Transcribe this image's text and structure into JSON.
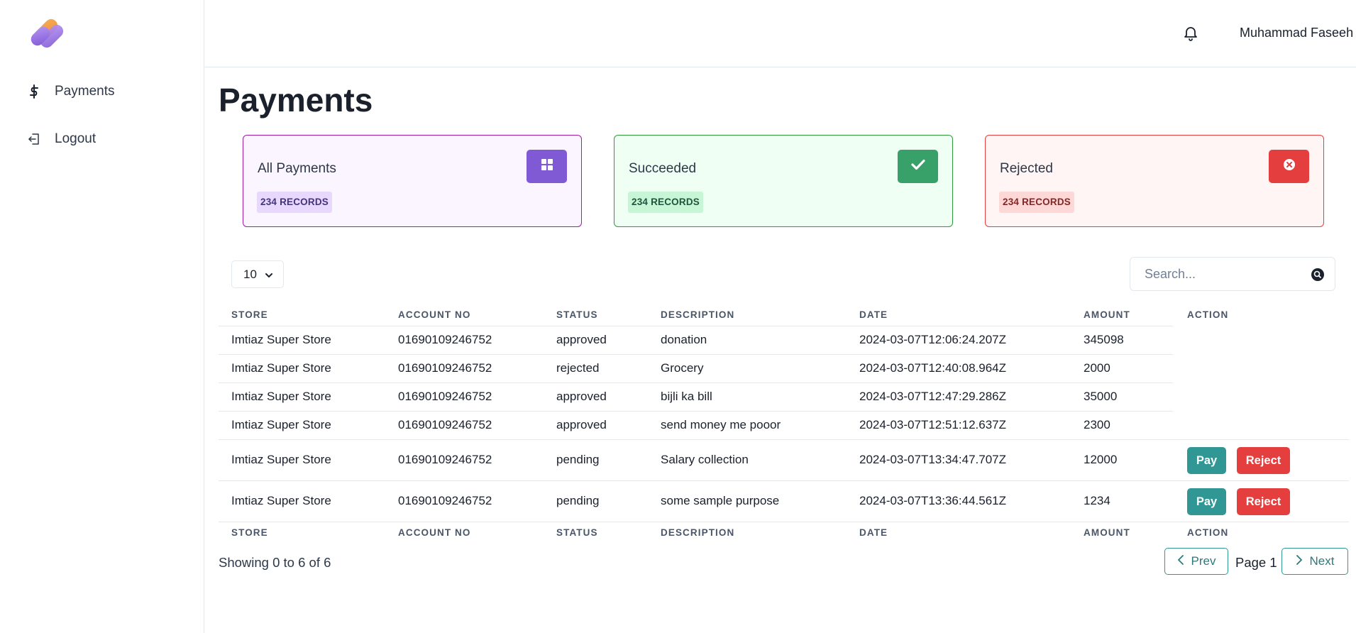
{
  "sidebar": {
    "logo_icon": "brand-logo",
    "items": [
      {
        "label": "Payments",
        "icon": "dollar-icon"
      },
      {
        "label": "Logout",
        "icon": "logout-icon"
      }
    ]
  },
  "header": {
    "notification_icon": "bell-icon",
    "user_name": "Muhammad Faseeh"
  },
  "page": {
    "title": "Payments"
  },
  "cards": [
    {
      "title": "All Payments",
      "badge": "234 RECORDS",
      "icon": "grid-icon",
      "color": "#805ad5"
    },
    {
      "title": "Succeeded",
      "badge": "234 RECORDS",
      "icon": "check-icon",
      "color": "#38a169"
    },
    {
      "title": "Rejected",
      "badge": "234 RECORDS",
      "icon": "x-circle-icon",
      "color": "#e53e3e"
    }
  ],
  "controls": {
    "page_size": "10",
    "search_placeholder": "Search..."
  },
  "table": {
    "columns": [
      "STORE",
      "ACCOUNT NO",
      "STATUS",
      "DESCRIPTION",
      "DATE",
      "AMOUNT",
      "ACTION"
    ],
    "rows": [
      {
        "store": "Imtiaz Super Store",
        "account": "01690109246752",
        "status": "approved",
        "description": "donation",
        "date": "2024-03-07T12:06:24.207Z",
        "amount": "345098"
      },
      {
        "store": "Imtiaz Super Store",
        "account": "01690109246752",
        "status": "rejected",
        "description": "Grocery",
        "date": "2024-03-07T12:40:08.964Z",
        "amount": "2000"
      },
      {
        "store": "Imtiaz Super Store",
        "account": "01690109246752",
        "status": "approved",
        "description": "bijli ka bill",
        "date": "2024-03-07T12:47:29.286Z",
        "amount": "35000"
      },
      {
        "store": "Imtiaz Super Store",
        "account": "01690109246752",
        "status": "approved",
        "description": "send money me pooor",
        "date": "2024-03-07T12:51:12.637Z",
        "amount": "2300"
      },
      {
        "store": "Imtiaz Super Store",
        "account": "01690109246752",
        "status": "pending",
        "description": "Salary collection",
        "date": "2024-03-07T13:34:47.707Z",
        "amount": "12000",
        "pay_label": "Pay",
        "reject_label": "Reject"
      },
      {
        "store": "Imtiaz Super Store",
        "account": "01690109246752",
        "status": "pending",
        "description": "some sample purpose",
        "date": "2024-03-07T13:36:44.561Z",
        "amount": "1234",
        "pay_label": "Pay",
        "reject_label": "Reject"
      }
    ]
  },
  "pagination": {
    "showing": "Showing 0 to 6 of 6",
    "prev_label": "Prev",
    "page_label": "Page 1",
    "next_label": "Next"
  }
}
